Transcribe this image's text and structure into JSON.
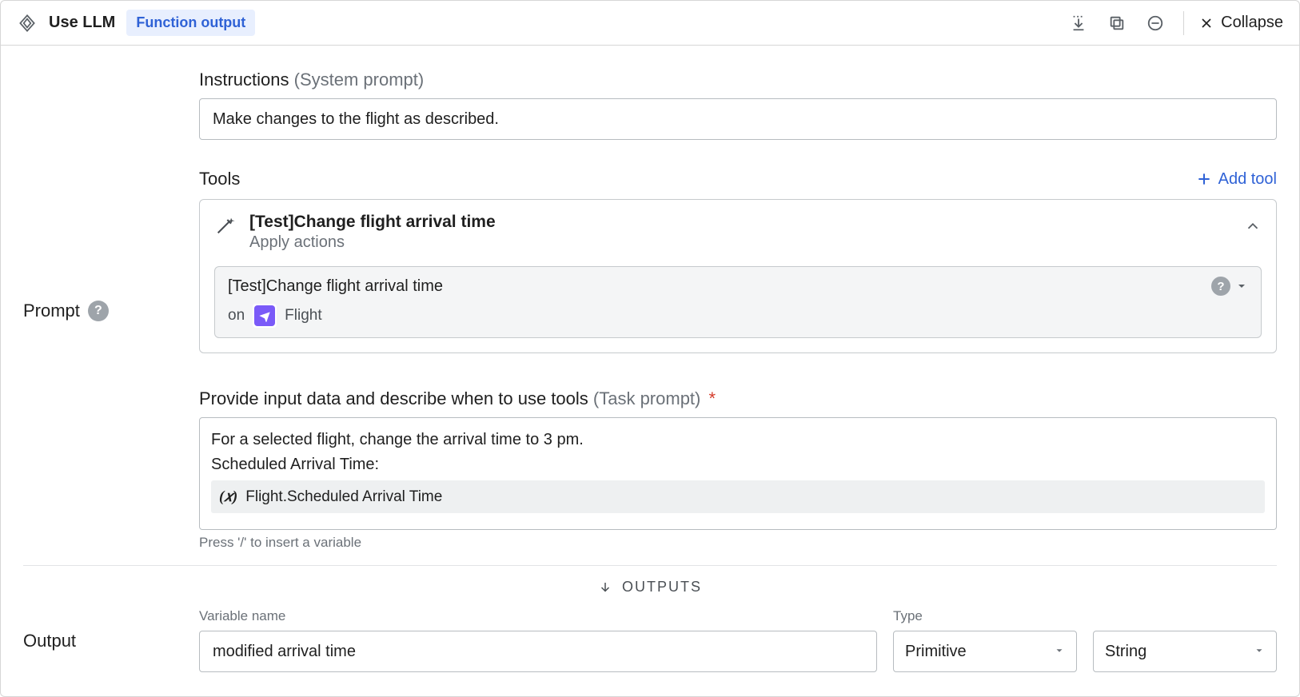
{
  "header": {
    "title": "Use LLM",
    "badge": "Function output",
    "collapse_label": "Collapse"
  },
  "prompt": {
    "side_label": "Prompt",
    "instructions_label": "Instructions",
    "instructions_hint": "(System prompt)",
    "instructions_value": "Make changes to the flight as described."
  },
  "tools": {
    "label": "Tools",
    "add_tool_label": "Add tool",
    "tool": {
      "title": "[Test]Change flight arrival time",
      "subtitle": "Apply actions",
      "inner_title": "[Test]Change flight arrival time",
      "on_word": "on",
      "entity": "Flight"
    }
  },
  "task": {
    "label": "Provide input data and describe when to use tools",
    "label_hint": "(Task prompt)",
    "line1": "For a selected flight, change the arrival time to 3 pm.",
    "line2": "Scheduled Arrival Time:",
    "var_pill": "Flight.Scheduled Arrival Time",
    "hint": "Press '/' to insert a variable"
  },
  "outputs": {
    "separator": "OUTPUTS",
    "side_label": "Output",
    "varname_label": "Variable name",
    "varname_value": "modified arrival time",
    "type_label": "Type",
    "type_kind": "Primitive",
    "type_value": "String"
  }
}
